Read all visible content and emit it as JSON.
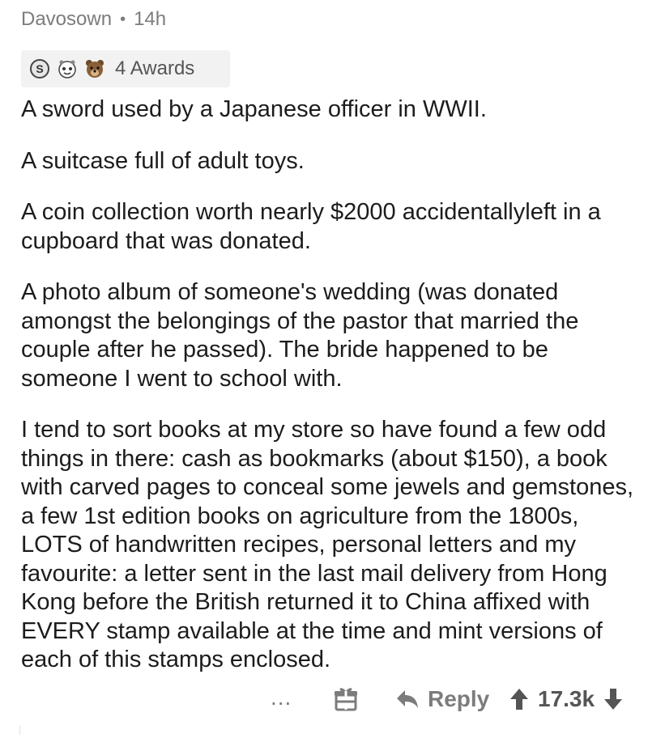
{
  "comment": {
    "author": "Davosown",
    "separator": "•",
    "age": "14h",
    "awards_label": "4 Awards",
    "awards_icons": [
      "silver-award-icon",
      "wholesome-award-icon",
      "bear-award-icon"
    ],
    "paragraphs": [
      "A sword used by a Japanese officer in WWII.",
      "A suitcase full of adult toys.",
      "A coin collection worth nearly $2000 accidentallyleft in a cupboard that was donated.",
      "A photo album of someone's wedding (was donated amongst the belongings of the pastor that married the couple after he passed). The bride happened to be someone I went to school with.",
      "I tend to sort books at my store so have found a few odd things in there: cash as bookmarks (about $150), a book with carved pages to conceal some jewels and gemstones, a few 1st edition books on agriculture from the 1800s, LOTS of handwritten recipes, personal letters and my favourite: a letter sent in the last mail delivery from Hong Kong before the British returned it to China affixed with EVERY stamp available at the time and mint versions of each of this stamps enclosed."
    ]
  },
  "actions": {
    "more_label": "...",
    "reply_label": "Reply",
    "score": "17.3k"
  },
  "colors": {
    "meta_text": "#7c7c7c",
    "body_text": "#1c1c1c",
    "awards_bg": "#f2f2f2"
  }
}
